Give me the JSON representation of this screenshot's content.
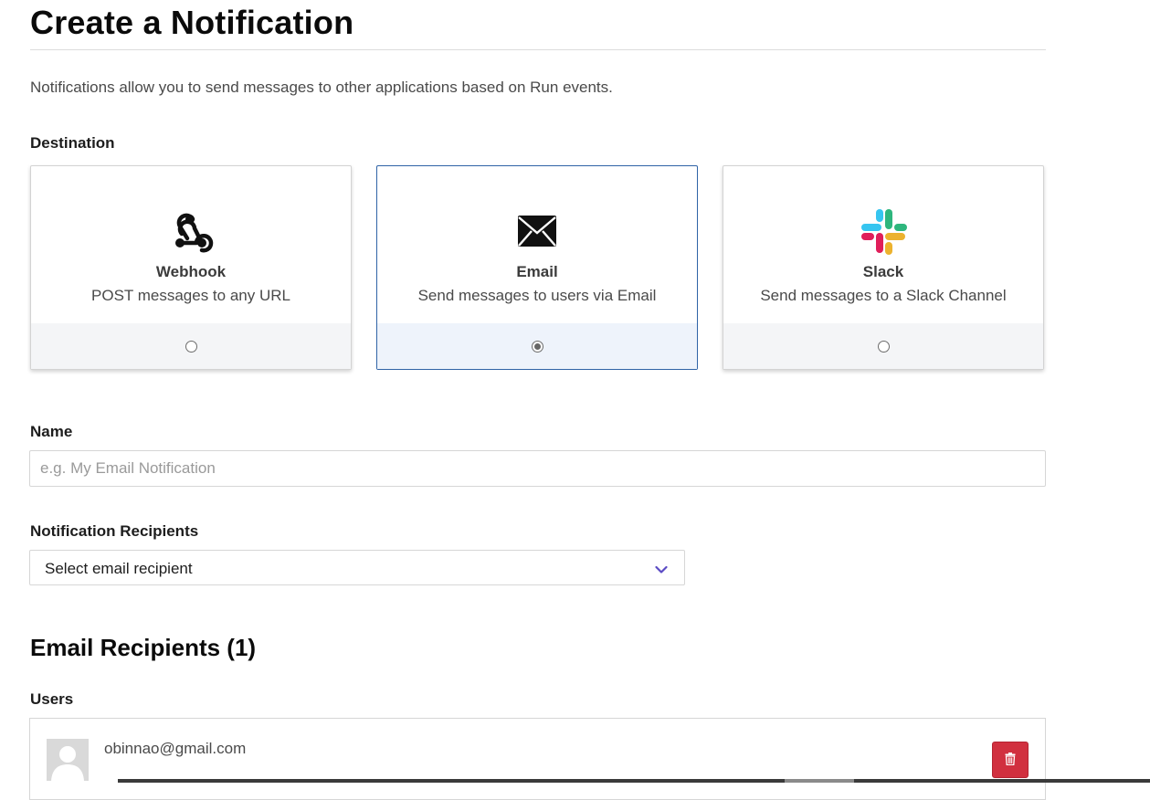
{
  "page": {
    "title": "Create a Notification",
    "intro": "Notifications allow you to send messages to other applications based on Run events."
  },
  "destination": {
    "label": "Destination",
    "selected": "email",
    "options": [
      {
        "id": "webhook",
        "name": "Webhook",
        "description": "POST messages to any URL",
        "icon": "webhook-icon",
        "checked": false
      },
      {
        "id": "email",
        "name": "Email",
        "description": "Send messages to users via Email",
        "icon": "envelope-icon",
        "checked": true
      },
      {
        "id": "slack",
        "name": "Slack",
        "description": "Send messages to a Slack Channel",
        "icon": "slack-logo-icon",
        "checked": false
      }
    ]
  },
  "name_field": {
    "label": "Name",
    "value": "",
    "placeholder": "e.g. My Email Notification"
  },
  "recipients_field": {
    "label": "Notification Recipients",
    "selected_value": "Select email recipient",
    "icon": "chevron-down-icon"
  },
  "email_recipients": {
    "title": "Email Recipients (1)",
    "users_label": "Users",
    "users": [
      {
        "email": "obinnao@gmail.com",
        "avatar_icon": "user-placeholder-avatar",
        "delete_icon": "trash-icon"
      }
    ]
  },
  "colors": {
    "selected_border": "#2f63a6",
    "selected_footer": "#eef3fb",
    "chevron": "#5b4bc4",
    "delete_button": "#d1303f",
    "slack_blue": "#36c5f0",
    "slack_green": "#2eb67d",
    "slack_red": "#e01e5a",
    "slack_yellow": "#ecb22e"
  }
}
